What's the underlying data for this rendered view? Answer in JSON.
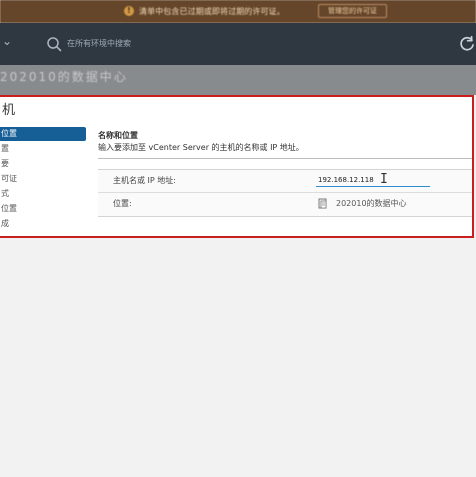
{
  "license_banner": {
    "message": "清单中包含已过期或即将过期的许可证。",
    "action_label": "管理您的许可证"
  },
  "top_nav": {
    "search_placeholder": "在所有环境中搜索"
  },
  "background_page": {
    "title": "202010的数据中心"
  },
  "dialog": {
    "title": "机",
    "steps": [
      {
        "label": "位置",
        "active": true
      },
      {
        "label": "置",
        "active": false
      },
      {
        "label": "要",
        "active": false
      },
      {
        "label": "可证",
        "active": false
      },
      {
        "label": "式",
        "active": false
      },
      {
        "label": "位置",
        "active": false
      },
      {
        "label": "成",
        "active": false
      }
    ],
    "section": {
      "heading": "名称和位置",
      "description": "输入要添加至 vCenter Server 的主机的名称或 IP 地址。"
    },
    "fields": {
      "host_label": "主机名或 IP 地址:",
      "host_value": "192.168.12.118",
      "location_label": "位置:",
      "location_value": "202010的数据中心"
    }
  },
  "colors": {
    "banner_background": "#66462a",
    "nav_background": "#2f3841",
    "highlight_border": "#c91f1f",
    "active_step": "#155f96",
    "input_underline": "#2f8ccf"
  },
  "icons": {
    "warning": "warning-icon",
    "search": "search-icon",
    "refresh": "refresh-icon",
    "location": "datacenter-icon",
    "cursor": "text-cursor-icon"
  }
}
